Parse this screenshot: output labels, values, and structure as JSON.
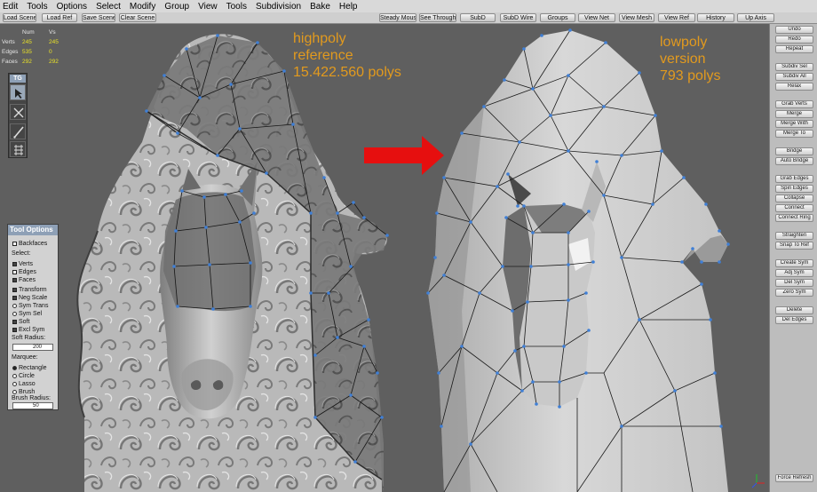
{
  "menu": [
    "Edit",
    "Tools",
    "Options",
    "Select",
    "Modify",
    "Group",
    "View",
    "Tools",
    "Subdivision",
    "Bake",
    "Help"
  ],
  "toolbar": {
    "left": [
      "Load Scene",
      "Load Ref",
      "Save Scene",
      "Clear Scene"
    ],
    "right": [
      "Steady Mouse",
      "See Through",
      "SubD",
      "SubD Wire",
      "Groups",
      "View Net",
      "View Mesh",
      "View Ref",
      "History",
      "Up Axis"
    ]
  },
  "stats": {
    "head": [
      "Num",
      "Vs"
    ],
    "rows": [
      {
        "label": "Verts",
        "num": "245",
        "vs": "245"
      },
      {
        "label": "Edges",
        "num": "535",
        "vs": "0"
      },
      {
        "label": "Faces",
        "num": "292",
        "vs": "292"
      }
    ]
  },
  "tg": {
    "title": "TG",
    "tools": [
      "select-arrow",
      "cut",
      "knife",
      "grid-snap"
    ]
  },
  "tool_options": {
    "title": "Tool Options",
    "backfaces": "Backfaces",
    "select_label": "Select:",
    "select": [
      "Verts",
      "Edges",
      "Faces"
    ],
    "toggles": [
      "Transform",
      "Neg Scale",
      "Sym Trans",
      "Sym Sel",
      "Soft",
      "Excl Sym"
    ],
    "soft_radius_label": "Soft Radius:",
    "soft_radius": "200",
    "marquee_label": "Marquee:",
    "marquee": [
      "Rectangle",
      "Circle",
      "Lasso",
      "Brush"
    ],
    "brush_radius_label": "Brush Radius:",
    "brush_radius": "50"
  },
  "notes": {
    "left": [
      "highpoly",
      "reference",
      "15.422.560 polys"
    ],
    "right": [
      "lowpoly",
      "version",
      "793 polys"
    ]
  },
  "right_panel": [
    "Undo",
    "Redo",
    "Repeat",
    "Subdiv Sel",
    "Subdiv All",
    "Relax",
    "Grab Verts",
    "Merge",
    "Merge With",
    "Merge To",
    "Bridge",
    "Auto Bridge",
    "Grab Edges",
    "Spin Edges",
    "Collapse",
    "Connect",
    "Connect Ring",
    "Straighten",
    "Snap To Ref",
    "Create Sym",
    "Adj Sym",
    "Del Sym",
    "Zero Sym",
    "Delete",
    "Del Edges",
    "Force Refresh"
  ],
  "colors": {
    "accent": "#8ea0b6",
    "note": "#e29a1e",
    "arrow": "#e60f0f",
    "verts": "#3f7fd6",
    "stat_value": "#e8e028"
  }
}
